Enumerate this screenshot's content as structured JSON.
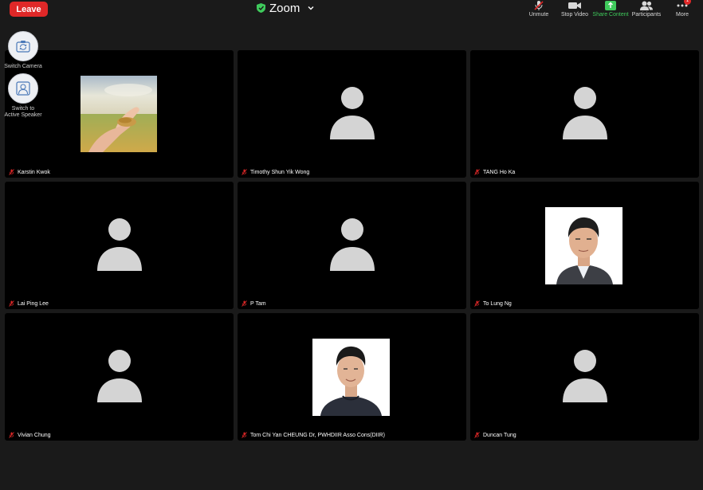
{
  "meeting": {
    "title": "Zoom",
    "leave_label": "Leave"
  },
  "toolbar": {
    "unmute_label": "Unmute",
    "stop_video_label": "Stop Video",
    "share_content_label": "Share Content",
    "participants_label": "Participants",
    "more_label": "More",
    "more_badge": "1"
  },
  "side": {
    "switch_camera_label": "Switch Camera",
    "switch_speaker_label_1": "Switch to",
    "switch_speaker_label_2": "Active Speaker"
  },
  "participants": [
    {
      "name": "Karstin Kwok",
      "muted": true,
      "video": "photo-wheat-hands"
    },
    {
      "name": "Timothy Shun Yik Wong",
      "muted": true,
      "video": "avatar-placeholder"
    },
    {
      "name": "TANG Ho Ka",
      "muted": true,
      "video": "avatar-placeholder"
    },
    {
      "name": "Lai Ping Lee",
      "muted": true,
      "video": "avatar-placeholder"
    },
    {
      "name": "P Tam",
      "muted": true,
      "video": "avatar-placeholder"
    },
    {
      "name": "To Lung Ng",
      "muted": true,
      "video": "photo-portrait"
    },
    {
      "name": "Vivian Chung",
      "muted": true,
      "video": "avatar-placeholder"
    },
    {
      "name": "Tom Chi Yan CHEUNG Dr, PWHDIIR Asso Cons(DIIR)",
      "muted": true,
      "video": "photo-portrait"
    },
    {
      "name": "Duncan Tung",
      "muted": true,
      "video": "avatar-placeholder"
    }
  ],
  "colors": {
    "leave": "#e02828",
    "share_green": "#3fcb5c",
    "background": "#1a1a1a",
    "tile": "#000000"
  }
}
